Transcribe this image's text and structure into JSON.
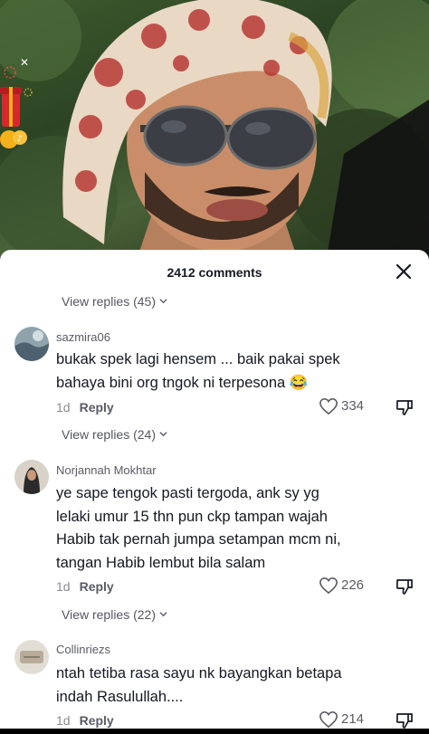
{
  "comments_sheet": {
    "title": "2412 comments"
  },
  "threads": [
    {
      "view_replies": "View replies (45)"
    },
    {
      "view_replies": "View replies (24)"
    },
    {
      "view_replies": "View replies (22)"
    }
  ],
  "comments": [
    {
      "username": "sazmira06",
      "text_lines": [
        "bukak spek lagi hensem ... baik pakai spek",
        "bahaya bini org tngok ni terpesona 😂"
      ],
      "time": "1d",
      "reply_label": "Reply",
      "likes": "334"
    },
    {
      "username": "Norjannah Mokhtar",
      "text_lines": [
        "ye sape tengok pasti tergoda, ank sy yg",
        "lelaki umur 15 thn pun ckp tampan wajah",
        "Habib tak pernah jumpa setampan mcm ni,",
        "tangan Habib lembut bila salam"
      ],
      "time": "1d",
      "reply_label": "Reply",
      "likes": "226"
    },
    {
      "username": "Collinriezs",
      "text_lines": [
        "ntah tetiba rasa sayu nk bayangkan betapa",
        "indah Rasulullah...."
      ],
      "time": "1d",
      "reply_label": "Reply",
      "likes": "214"
    }
  ],
  "icons": {
    "close": "close-icon",
    "chevron": "chevron-down-icon",
    "like": "heart-outline-icon",
    "dislike": "thumbs-down-icon",
    "gift": "gift-box-icon"
  },
  "colors": {
    "sheet_bg": "#ffffff",
    "text_primary": "#161823",
    "text_secondary": "#5a5b64",
    "gift_red": "#d6282e",
    "coin_gold": "#f5b11a"
  }
}
